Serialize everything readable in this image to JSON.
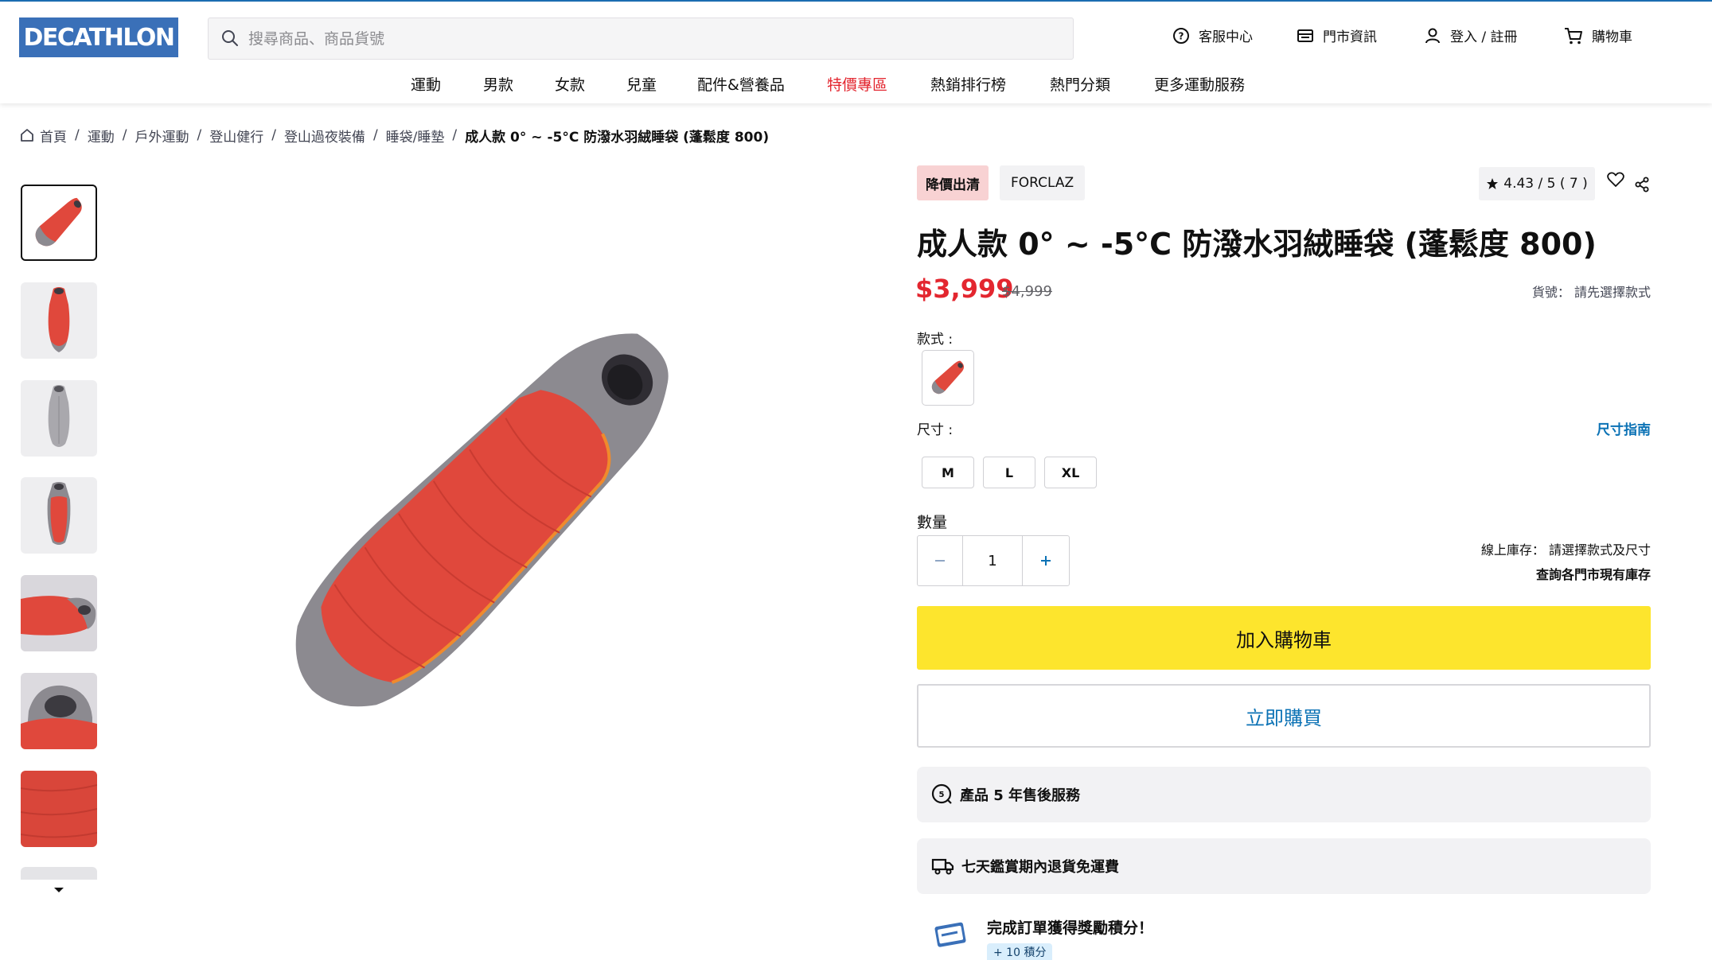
{
  "header": {
    "logo": "DECATHLON",
    "search_placeholder": "搜尋商品、商品貨號",
    "links": {
      "help": "客服中心",
      "stores": "門市資訊",
      "login": "登入 / 註冊",
      "cart": "購物車"
    }
  },
  "nav": {
    "items": [
      "運動",
      "男款",
      "女款",
      "兒童",
      "配件&營養品",
      "特價專區",
      "熱銷排行榜",
      "熱門分類",
      "更多運動服務"
    ]
  },
  "breadcrumb": {
    "items": [
      "首頁",
      "運動",
      "戶外運動",
      "登山健行",
      "登山過夜裝備",
      "睡袋/睡墊"
    ],
    "current": "成人款 0° ~ -5°C 防潑水羽絨睡袋 (蓬鬆度 800)"
  },
  "product": {
    "badge": "降價出清",
    "brand": "FORCLAZ",
    "rating": "4.43 / 5 ( 7 )",
    "title": "成人款 0° ~ -5°C 防潑水羽絨睡袋 (蓬鬆度 800)",
    "price": "$3,999",
    "old_price": "$4,999",
    "sku": "貨號： 請先選擇款式",
    "style_label": "款式 :",
    "size_label": "尺寸 :",
    "size_guide": "尺寸指南",
    "sizes": [
      "M",
      "L",
      "XL"
    ],
    "qty_label": "數量",
    "qty_value": "1",
    "stock": "線上庫存： 請選擇款式及尺寸",
    "store_stock": "查詢各門市現有庫存",
    "add_to_cart": "加入購物車",
    "buy_now": "立即購買",
    "services": [
      "產品 5 年售後服務",
      "七天鑑賞期內退貨免運費"
    ],
    "reward_title": "完成訂單獲得獎勵積分！",
    "reward_points": "+ 10 積分"
  },
  "colors": {
    "brand_blue": "#3a70b8",
    "sale_red": "#e3262f",
    "cart_yellow": "#fde52d",
    "link_blue": "#0b72b5",
    "product_red": "#e0483c",
    "product_grey": "#8c8a90"
  },
  "icons": [
    "search-icon",
    "help-circle-icon",
    "store-icon",
    "user-icon",
    "cart-icon",
    "home-icon",
    "star-icon",
    "heart-icon",
    "share-icon",
    "minus-icon",
    "plus-icon",
    "warranty-icon",
    "truck-icon",
    "reward-icon",
    "chevron-down-icon"
  ]
}
